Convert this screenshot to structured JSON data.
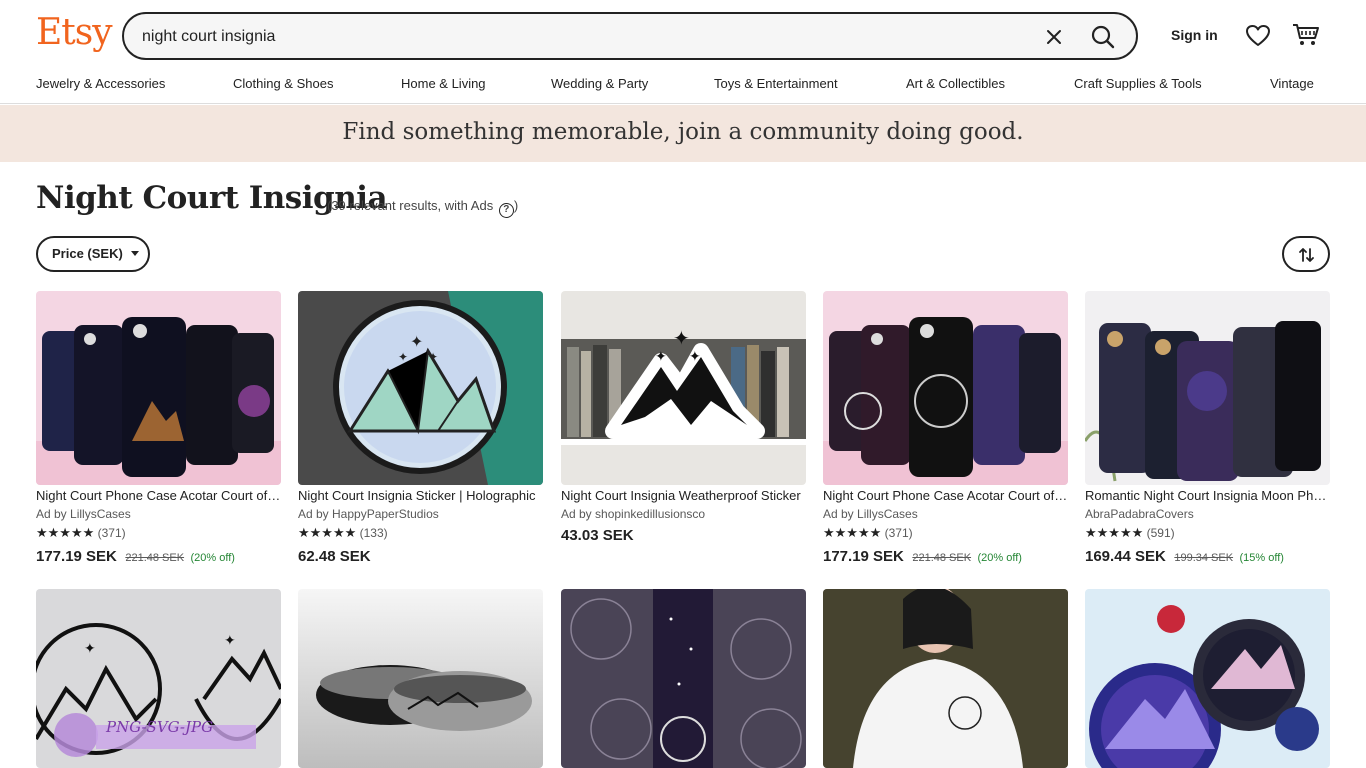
{
  "header": {
    "logo": "Etsy",
    "search_value": "night court insignia",
    "signin_label": "Sign in"
  },
  "nav": [
    "Jewelry & Accessories",
    "Clothing & Shoes",
    "Home & Living",
    "Wedding & Party",
    "Toys & Entertainment",
    "Art & Collectibles",
    "Craft Supplies & Tools",
    "Vintage"
  ],
  "banner": {
    "text": "Find something memorable, join a community doing good."
  },
  "results": {
    "title": "Night Court Insignia",
    "count_text": "(39 relevant results, with Ads",
    "count_close": ")",
    "help_glyph": "?",
    "price_filter_label": "Price (SEK)"
  },
  "products": [
    {
      "title": "Night Court Phone Case Acotar Court of Dreams",
      "shop": "Ad by LillysCases",
      "stars": "★★★★★",
      "reviews": "(371)",
      "price": "177.19 SEK",
      "original_price": "221.48 SEK",
      "discount": "(20% off)"
    },
    {
      "title": "Night Court Insignia Sticker | Holographic",
      "shop": "Ad by HappyPaperStudios",
      "stars": "★★★★★",
      "reviews": "(133)",
      "price": "62.48 SEK",
      "original_price": "",
      "discount": ""
    },
    {
      "title": "Night Court Insignia Weatherproof Sticker",
      "shop": "Ad by shopinkedillusionsco",
      "stars": "",
      "reviews": "",
      "price": "43.03 SEK",
      "original_price": "",
      "discount": ""
    },
    {
      "title": "Night Court Phone Case Acotar Court of Dreams",
      "shop": "Ad by LillysCases",
      "stars": "★★★★★",
      "reviews": "(371)",
      "price": "177.19 SEK",
      "original_price": "221.48 SEK",
      "discount": "(20% off)"
    },
    {
      "title": "Romantic Night Court Insignia Moon Phone Case",
      "shop": "AbraPadabraCovers",
      "stars": "★★★★★",
      "reviews": "(591)",
      "price": "169.44 SEK",
      "original_price": "199.34 SEK",
      "discount": "(15% off)"
    }
  ],
  "second_row_watermark": "PNG-SVG-JPG",
  "colors": {
    "brand": "#f1641e",
    "banner_bg": "#f3e6de",
    "discount_green": "#258635"
  },
  "icons": [
    "clear-icon",
    "search-icon",
    "heart-icon",
    "cart-icon",
    "help-icon",
    "caret-down-icon",
    "sort-icon"
  ]
}
